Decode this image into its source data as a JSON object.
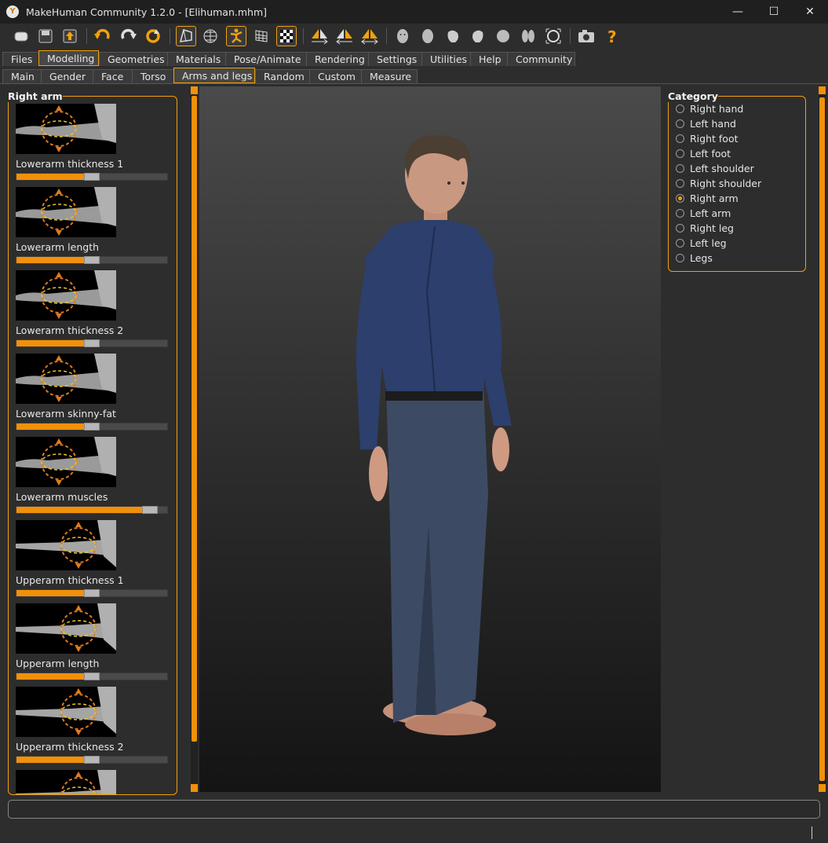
{
  "window": {
    "title": "MakeHuman Community 1.2.0 - [Elihuman.mhm]",
    "app_icon_letter": "Y",
    "controls": {
      "minimize": "—",
      "maximize": "☐",
      "close": "✕"
    }
  },
  "toolbar": {
    "icons": [
      "new-icon",
      "save-icon",
      "export-icon",
      "undo-icon",
      "redo-icon",
      "reset-icon",
      "smooth-icon",
      "wireframe-icon",
      "pose-icon",
      "grid-icon",
      "checker-icon",
      "symmetry-right-icon",
      "symmetry-left-icon",
      "symmetry-icon",
      "front-view-icon",
      "back-view-icon",
      "left-view-icon",
      "right-view-icon",
      "top-view-icon",
      "bottom-view-icon",
      "reset-camera-icon",
      "screenshot-icon",
      "help-icon"
    ]
  },
  "main_tabs": [
    "Files",
    "Modelling",
    "Geometries",
    "Materials",
    "Pose/Animate",
    "Rendering",
    "Settings",
    "Utilities",
    "Help",
    "Community"
  ],
  "main_tab_active": "Modelling",
  "sub_tabs": [
    "Main",
    "Gender",
    "Face",
    "Torso",
    "Arms and legs",
    "Random",
    "Custom",
    "Measure"
  ],
  "sub_tab_active": "Arms and legs",
  "left_panel": {
    "title": "Right arm",
    "modifiers": [
      {
        "label": "Lowerarm thickness 1",
        "value": 0.5
      },
      {
        "label": "Lowerarm length",
        "value": 0.5
      },
      {
        "label": "Lowerarm thickness 2",
        "value": 0.5
      },
      {
        "label": "Lowerarm skinny-fat",
        "value": 0.5
      },
      {
        "label": "Lowerarm muscles",
        "value": 0.93
      },
      {
        "label": "Upperarm thickness 1",
        "value": 0.5
      },
      {
        "label": "Upperarm length",
        "value": 0.5
      },
      {
        "label": "Upperarm thickness 2",
        "value": 0.5
      }
    ]
  },
  "right_panel": {
    "title": "Category",
    "options": [
      "Right hand",
      "Left hand",
      "Right foot",
      "Left foot",
      "Left shoulder",
      "Right shoulder",
      "Right arm",
      "Left arm",
      "Right leg",
      "Left leg",
      "Legs"
    ],
    "selected": "Right arm"
  },
  "colors": {
    "accent": "#f2a10a",
    "background": "#2d2d2d",
    "slider_fill": "#f2900a"
  }
}
